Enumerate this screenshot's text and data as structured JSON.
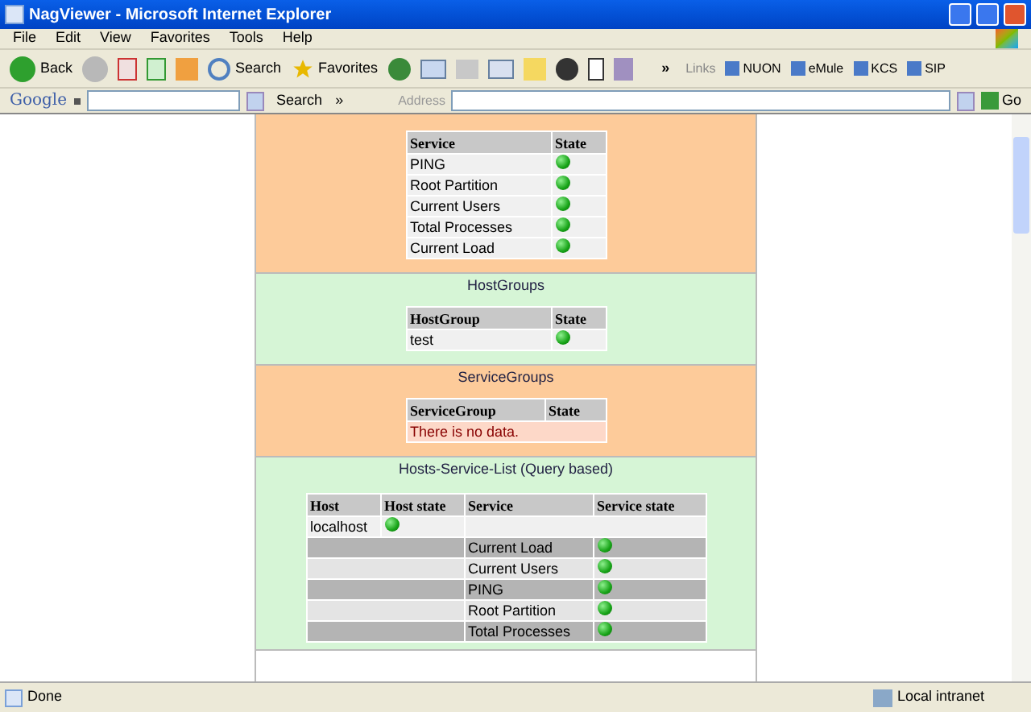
{
  "window": {
    "title": "NagViewer - Microsoft Internet Explorer"
  },
  "menu": [
    "File",
    "Edit",
    "View",
    "Favorites",
    "Tools",
    "Help"
  ],
  "toolbar": {
    "back": "Back",
    "search": "Search",
    "favorites": "Favorites",
    "more": "»"
  },
  "links": {
    "label": "Links",
    "items": [
      "NUON",
      "eMule",
      "KCS",
      "SIP"
    ]
  },
  "google": {
    "logo": "Google",
    "search": "Search",
    "more": "»"
  },
  "address": {
    "label": "Address",
    "go": "Go"
  },
  "sections": [
    {
      "color": "#fdcb9a",
      "kind": "table",
      "columns": [
        "Service",
        "State"
      ],
      "rows": [
        {
          "name": "PING",
          "ok": true
        },
        {
          "name": "Root Partition",
          "ok": true
        },
        {
          "name": "Current Users",
          "ok": true
        },
        {
          "name": "Total Processes",
          "ok": true
        },
        {
          "name": "Current Load",
          "ok": true
        }
      ]
    },
    {
      "title": "HostGroups",
      "color": "#d6f5d6",
      "kind": "table",
      "columns": [
        "HostGroup",
        "State"
      ],
      "rows": [
        {
          "name": "test",
          "ok": true
        }
      ]
    },
    {
      "title": "ServiceGroups",
      "color": "#fdcb9a",
      "kind": "empty",
      "columns": [
        "ServiceGroup",
        "State"
      ],
      "message": "There is no data."
    },
    {
      "title": "Hosts-Service-List (Query based)",
      "color": "#d6f5d6",
      "kind": "hosts",
      "columns": [
        "Host",
        "Host state",
        "Service",
        "Service state"
      ],
      "hosts": [
        {
          "name": "localhost",
          "ok": true,
          "services": [
            {
              "name": "Current Load",
              "ok": true
            },
            {
              "name": "Current Users",
              "ok": true
            },
            {
              "name": "PING",
              "ok": true
            },
            {
              "name": "Root Partition",
              "ok": true
            },
            {
              "name": "Total Processes",
              "ok": true
            }
          ]
        }
      ]
    }
  ],
  "status_bar": {
    "text": "Done",
    "zone": "Local intranet"
  }
}
